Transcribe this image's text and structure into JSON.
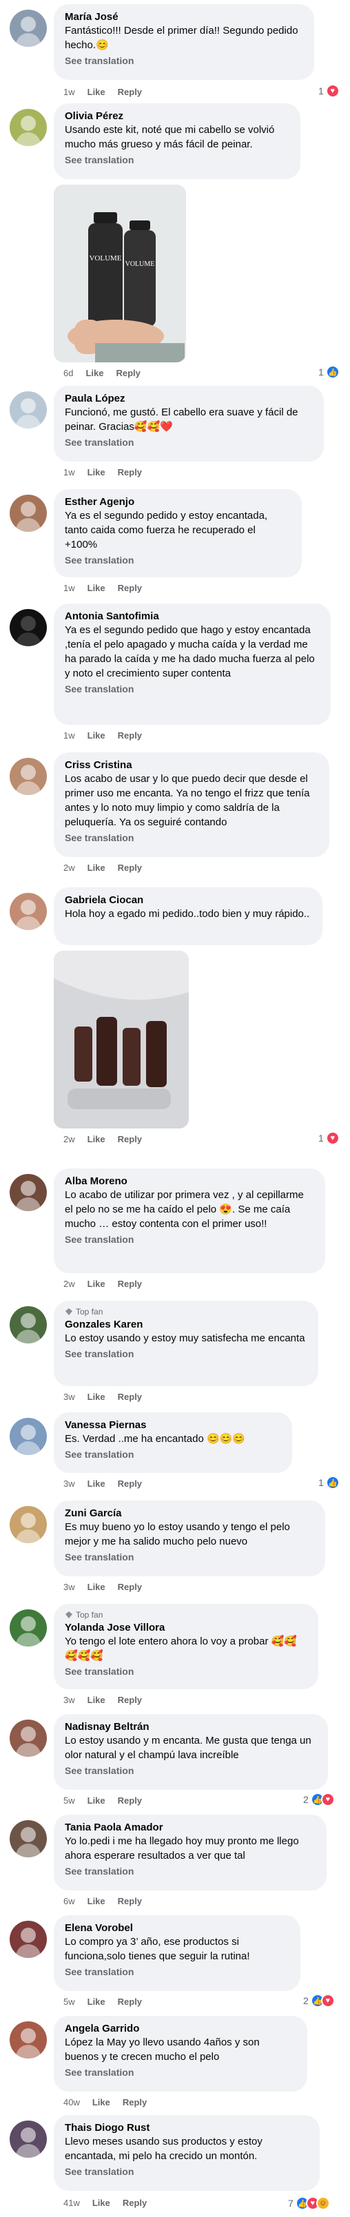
{
  "ui": {
    "see_translation": "See translation",
    "like": "Like",
    "reply": "Reply",
    "top_fan": "Top fan"
  },
  "comments": [
    {
      "name": "María José",
      "text": "Fantástico!!! Desde el primer día!! Segundo pedido hecho.😊",
      "time": "1w",
      "reactions": "1"
    },
    {
      "name": "Olivia Pérez",
      "text": "Usando este kit, noté que mi cabello se volvió mucho más grueso y más fácil de peinar.",
      "time": "6d",
      "reactions": "1"
    },
    {
      "name": "Paula López",
      "text": "Funcionó, me gustó. El cabello era suave y fácil de peinar. Gracias🥰🥰❤️",
      "time": "1w",
      "reactions": ""
    },
    {
      "name": "Esther Agenjo",
      "text": "Ya es el segundo pedido y estoy encantada, tanto caida como fuerza he recuperado el +100%",
      "time": "1w",
      "reactions": ""
    },
    {
      "name": "Antonia Santofimia",
      "text": "Ya es el segundo pedido que hago y estoy encantada ,tenía el pelo apagado y mucha caída y la verdad me ha parado la caída y me ha dado mucha fuerza al pelo y noto el crecimiento super contenta",
      "time": "1w",
      "reactions": ""
    },
    {
      "name": "Criss Cristina",
      "text": "Los acabo de usar y lo que puedo decir que desde el primer uso me encanta. Ya no tengo el frizz que tenía antes y lo noto muy limpio y como saldría de la peluquería. Ya os seguiré contando",
      "time": "2w",
      "reactions": ""
    },
    {
      "name": "Gabriela Ciocan",
      "text": "Hola hoy a egado  mi pedido..todo bien  y muy rápido..",
      "time": "2w",
      "reactions": "1"
    },
    {
      "name": "Alba Moreno",
      "text": "Lo acabo de utilizar por primera vez , y al cepillarme el pelo no se me ha caído el pelo 😍. Se me caía mucho … estoy contenta con el primer uso!!",
      "time": "2w",
      "reactions": ""
    },
    {
      "name": "Gonzales Karen",
      "text": "Lo estoy usando  y estoy muy satisfecha me encanta",
      "time": "3w",
      "reactions": ""
    },
    {
      "name": "Vanessa Piernas",
      "text": "Es. Verdad ..me ha encantado  😊😊😊",
      "time": "3w",
      "reactions": "1"
    },
    {
      "name": "Zuni García",
      "text": "Es muy bueno yo lo estoy usando y tengo el pelo mejor y me ha salido mucho pelo nuevo",
      "time": "3w",
      "reactions": ""
    },
    {
      "name": "Yolanda Jose Villora",
      "text": "Yo tengo el lote entero ahora lo voy a probar 🥰🥰🥰🥰🥰",
      "time": "3w",
      "reactions": ""
    },
    {
      "name": "Nadisnay Beltrán",
      "text": "Lo estoy usando y m encanta. Me gusta que tenga un olor natural y el champú lava increíble",
      "time": "5w",
      "reactions": "2"
    },
    {
      "name": "Tania Paola Amador",
      "text": "Yo lo.pedi i me ha llegado hoy muy pronto me llego ahora esperare resultados a ver que tal",
      "time": "6w",
      "reactions": ""
    },
    {
      "name": "Elena Vorobel",
      "text": "Lo compro ya 3’ año, ese productos si funciona,solo tienes que seguir la rutina!",
      "time": "5w",
      "reactions": "2"
    },
    {
      "name": "Angela Garrido",
      "text": "López la May yo llevo usando 4años  y son buenos y te crecen mucho el pelo",
      "time": "40w",
      "reactions": ""
    },
    {
      "name": "Thais Diogo Rust",
      "text": "Llevo meses usando sus productos y estoy encantada, mi pelo ha crecido un montón.",
      "time": "41w",
      "reactions": "7"
    }
  ]
}
